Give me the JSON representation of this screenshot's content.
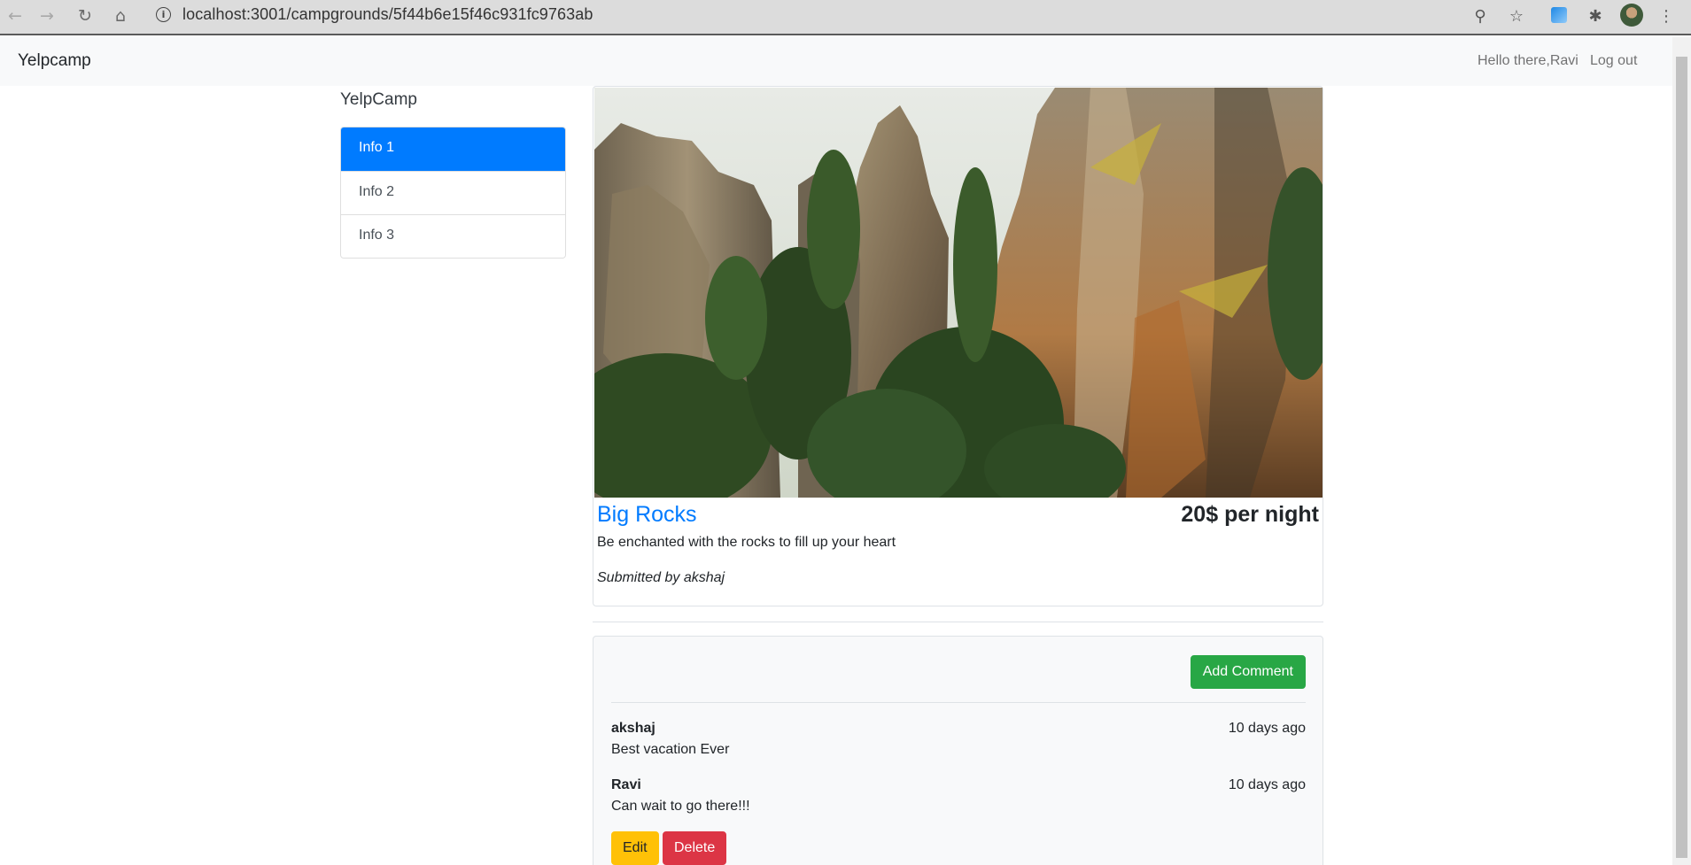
{
  "browser": {
    "url": "localhost:3001/campgrounds/5f44b6e15f46c931fc9763ab",
    "back_icon": "←",
    "forward_icon": "→",
    "reload_icon": "↻",
    "home_icon": "⌂",
    "info_icon": "i",
    "zoom_icon": "⚲",
    "star_icon": "☆",
    "extensions_icon": "✱",
    "menu_icon": "⋮"
  },
  "navbar": {
    "brand": "Yelpcamp",
    "greeting": "Hello there,Ravi",
    "logout": "Log out"
  },
  "sidebar": {
    "title": "YelpCamp",
    "items": [
      {
        "label": "Info 1",
        "active": true
      },
      {
        "label": "Info 2",
        "active": false
      },
      {
        "label": "Info 3",
        "active": false
      }
    ]
  },
  "campground": {
    "name": "Big Rocks",
    "price": "20$ per night",
    "description": "Be enchanted with the rocks to fill up your heart",
    "submitted_by": "Submitted by akshaj"
  },
  "comments": {
    "add_label": "Add Comment",
    "items": [
      {
        "author": "akshaj",
        "time": "10 days ago",
        "text": "Best vacation Ever"
      },
      {
        "author": "Ravi",
        "time": "10 days ago",
        "text": "Can wait to go there!!!"
      }
    ],
    "edit_label": "Edit",
    "delete_label": "Delete"
  },
  "colors": {
    "primary": "#007bff",
    "success": "#28a745",
    "warning": "#ffc107",
    "danger": "#dc3545"
  }
}
